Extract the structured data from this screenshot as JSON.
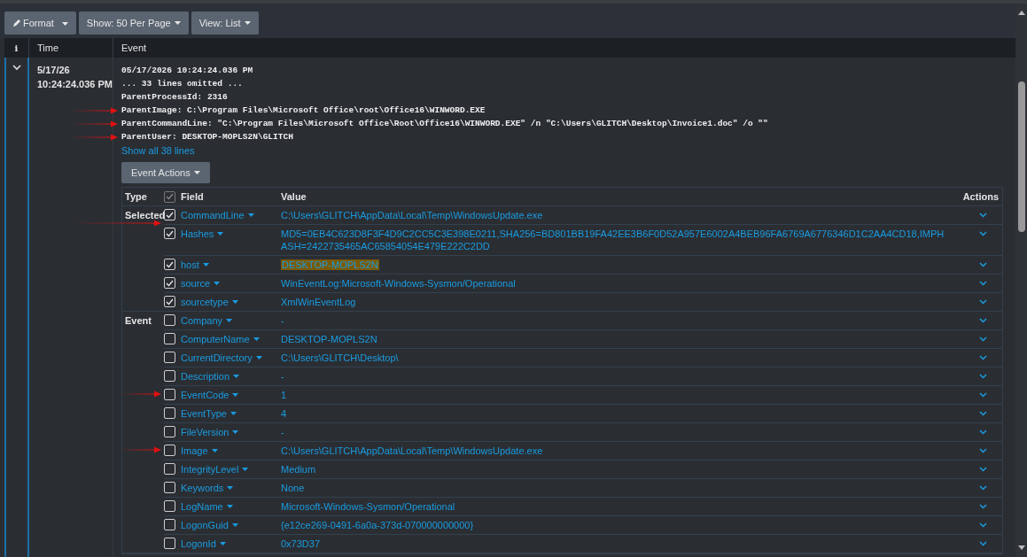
{
  "toolbar": [
    {
      "label": "Format",
      "kind": "format"
    },
    {
      "label": "Show: 50 Per Page",
      "kind": "menu"
    },
    {
      "label": "View: List",
      "kind": "menu"
    }
  ],
  "columns": {
    "info": "i",
    "time": "Time",
    "event": "Event"
  },
  "event": {
    "expanded": true,
    "time": [
      "5/17/26",
      "10:24:24.036 PM"
    ],
    "lines": [
      {
        "text": "05/17/2026 10:24:24.036 PM",
        "marked": false
      },
      {
        "text": "... 33 lines omitted ...",
        "marked": false
      },
      {
        "text": "ParentProcessId: 2316",
        "marked": false
      },
      {
        "text": "ParentImage: C:\\Program Files\\Microsoft Office\\root\\Office16\\WINWORD.EXE",
        "marked": true
      },
      {
        "text": "ParentCommandLine: \"C:\\Program Files\\Microsoft Office\\Root\\Office16\\WINWORD.EXE\" /n \"C:\\Users\\GLITCH\\Desktop\\Invoice1.doc\" /o \"\"",
        "marked": true
      },
      {
        "text": "ParentUser: DESKTOP-MOPLS2N\\GLITCH",
        "marked": true
      }
    ],
    "show_all": "Show all 38 lines",
    "actions_button": "Event Actions"
  },
  "fields_table": {
    "columns": {
      "type": "Type",
      "field": "Field",
      "value": "Value",
      "actions": "Actions"
    },
    "select_all_checked": true,
    "groups": [
      {
        "type": "Selected",
        "fields": [
          {
            "name": "CommandLine",
            "value": "C:\\Users\\GLITCH\\AppData\\Local\\Temp\\WindowsUpdate.exe",
            "checked": true,
            "marked": true,
            "highlighted": false
          },
          {
            "name": "Hashes",
            "value": "MD5=0EB4C623D8F3F4D9C2CC5C3E398E0211,SHA256=BD801BB19FA42EE3B6F0D52A957E6002A4BEB96FA6769A6776346D1C2AA4CD18,IMPHASH=2422735465AC65854054E479E222C2DD",
            "checked": true,
            "marked": false,
            "highlighted": false
          },
          {
            "name": "host",
            "value": "DESKTOP-MOPLS2N",
            "checked": true,
            "marked": false,
            "highlighted": true
          },
          {
            "name": "source",
            "value": "WinEventLog:Microsoft-Windows-Sysmon/Operational",
            "checked": true,
            "marked": false,
            "highlighted": false
          },
          {
            "name": "sourcetype",
            "value": "XmlWinEventLog",
            "checked": true,
            "marked": false,
            "highlighted": false
          }
        ]
      },
      {
        "type": "Event",
        "fields": [
          {
            "name": "Company",
            "value": "-",
            "checked": false,
            "marked": false,
            "highlighted": false
          },
          {
            "name": "ComputerName",
            "value": "DESKTOP-MOPLS2N",
            "checked": false,
            "marked": false,
            "highlighted": false
          },
          {
            "name": "CurrentDirectory",
            "value": "C:\\Users\\GLITCH\\Desktop\\",
            "checked": false,
            "marked": false,
            "highlighted": false
          },
          {
            "name": "Description",
            "value": "-",
            "checked": false,
            "marked": false,
            "highlighted": false
          },
          {
            "name": "EventCode",
            "value": "1",
            "checked": false,
            "marked": true,
            "highlighted": false
          },
          {
            "name": "EventType",
            "value": "4",
            "checked": false,
            "marked": false,
            "highlighted": false
          },
          {
            "name": "FileVersion",
            "value": "-",
            "checked": false,
            "marked": false,
            "highlighted": false
          },
          {
            "name": "Image",
            "value": "C:\\Users\\GLITCH\\AppData\\Local\\Temp\\WindowsUpdate.exe",
            "checked": false,
            "marked": true,
            "highlighted": false
          },
          {
            "name": "IntegrityLevel",
            "value": "Medium",
            "checked": false,
            "marked": false,
            "highlighted": false
          },
          {
            "name": "Keywords",
            "value": "None",
            "checked": false,
            "marked": false,
            "highlighted": false
          },
          {
            "name": "LogName",
            "value": "Microsoft-Windows-Sysmon/Operational",
            "checked": false,
            "marked": false,
            "highlighted": false
          },
          {
            "name": "LogonGuid",
            "value": "{e12ce269-0491-6a0a-373d-070000000000}",
            "checked": false,
            "marked": false,
            "highlighted": false
          },
          {
            "name": "LogonId",
            "value": "0x73D37",
            "checked": false,
            "marked": false,
            "highlighted": false
          }
        ]
      }
    ]
  }
}
